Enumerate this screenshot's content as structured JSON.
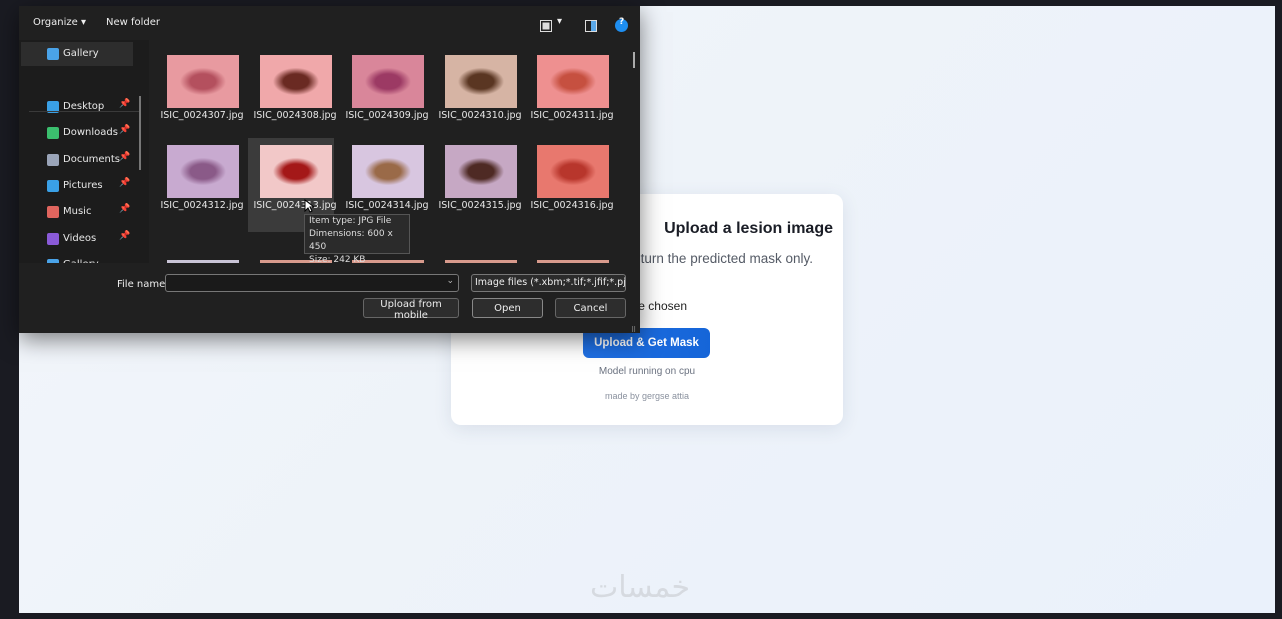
{
  "page": {
    "title": "Upload a lesion image",
    "description": "The server will return the predicted mask only.",
    "file_status": "No file chosen",
    "upload_button": "Upload & Get Mask",
    "model_note": "Model running on cpu",
    "credit": "made by gergse attia",
    "watermark": "خمسات"
  },
  "dialog": {
    "toolbar": {
      "organize": "Organize ▾",
      "new_folder": "New folder",
      "view_chevron": "▾",
      "help": "?"
    },
    "nav": [
      {
        "label": "Gallery",
        "icon": "gallery-icon",
        "color": "#4aa3e8",
        "pinned": false
      },
      {
        "label": "Desktop",
        "icon": "desktop-icon",
        "color": "#3aa0e6",
        "pinned": true
      },
      {
        "label": "Downloads",
        "icon": "download-icon",
        "color": "#3bbf6e",
        "pinned": true
      },
      {
        "label": "Documents",
        "icon": "documents-icon",
        "color": "#9aa4b8",
        "pinned": true
      },
      {
        "label": "Pictures",
        "icon": "pictures-icon",
        "color": "#3aa0e6",
        "pinned": true
      },
      {
        "label": "Music",
        "icon": "music-icon",
        "color": "#e0655e",
        "pinned": true
      },
      {
        "label": "Videos",
        "icon": "videos-icon",
        "color": "#8a5ad8",
        "pinned": true
      },
      {
        "label": "Gallery",
        "icon": "gallery-icon",
        "color": "#4aa3e8",
        "pinned": false
      }
    ],
    "pin_glyph": "📌",
    "files": [
      {
        "name": "ISIC_0024307.jpg",
        "bg": "#e89aa0",
        "spot": "#b4505e"
      },
      {
        "name": "ISIC_0024308.jpg",
        "bg": "#f0a8aa",
        "spot": "#6a2a22"
      },
      {
        "name": "ISIC_0024309.jpg",
        "bg": "#d9869a",
        "spot": "#9c3a64"
      },
      {
        "name": "ISIC_0024310.jpg",
        "bg": "#d6b4a4",
        "spot": "#5a3622"
      },
      {
        "name": "ISIC_0024311.jpg",
        "bg": "#ee9090",
        "spot": "#c65040"
      },
      {
        "name": "ISIC_0024312.jpg",
        "bg": "#c8aad0",
        "spot": "#8a5a88"
      },
      {
        "name": "ISIC_0024313.jpg",
        "bg": "#f2c8c8",
        "spot": "#a41818"
      },
      {
        "name": "ISIC_0024314.jpg",
        "bg": "#d8c6e0",
        "spot": "#9a6a48"
      },
      {
        "name": "ISIC_0024315.jpg",
        "bg": "#c6a8c4",
        "spot": "#4e2a24"
      },
      {
        "name": "ISIC_0024316.jpg",
        "bg": "#e8786e",
        "spot": "#b8362c"
      }
    ],
    "tooltip": {
      "type": "Item type: JPG File",
      "dimensions": "Dimensions: 600 x 450",
      "size": "Size: 242 KB"
    },
    "file_name_label": "File name:",
    "file_name_value": "",
    "filter": "Image files (*.xbm;*.tif;*.jfif;*.pjp",
    "buttons": {
      "upload_mobile": "Upload from mobile",
      "open": "Open",
      "cancel": "Cancel"
    }
  }
}
